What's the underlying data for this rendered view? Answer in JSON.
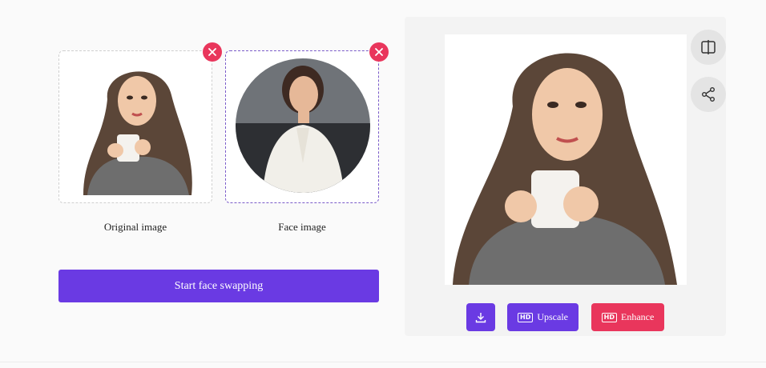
{
  "source": {
    "original_label": "Original image",
    "face_label": "Face image"
  },
  "actions": {
    "start_label": "Start face swapping",
    "upscale_label": "Upscale",
    "enhance_label": "Enhance",
    "hd_badge": "HD"
  },
  "icons": {
    "remove": "close-icon",
    "compare": "split-compare-icon",
    "share": "share-icon",
    "download": "download-icon"
  },
  "colors": {
    "accent": "#6a3ae3",
    "danger": "#e9365c"
  }
}
